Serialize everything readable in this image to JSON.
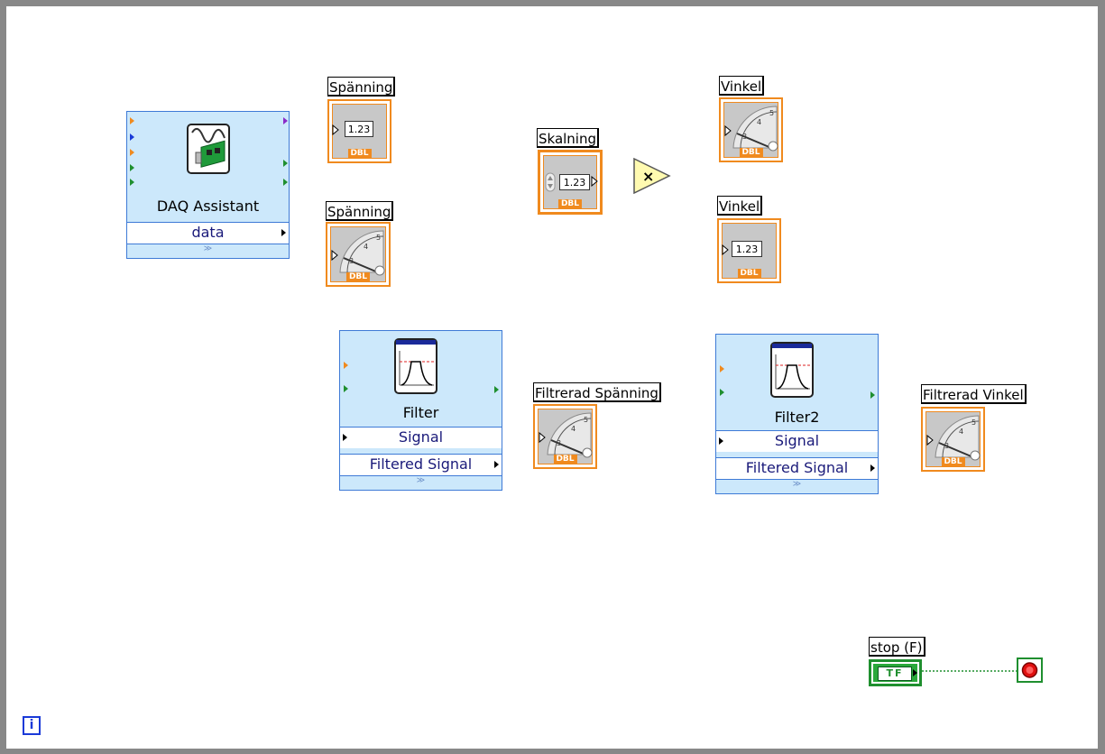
{
  "labels": {
    "spanning_num": "Spänning",
    "spanning_gauge": "Spänning",
    "skalning": "Skalning",
    "vinkel_gauge": "Vinkel",
    "vinkel_num": "Vinkel",
    "filtrerad_spanning": "Filtrerad Spänning",
    "filtrerad_vinkel": "Filtrerad Vinkel",
    "stop": "stop (F)"
  },
  "numeric_display": "1.23",
  "type_badge": "DBL",
  "multiply_symbol": "×",
  "stop_constant": "TF",
  "loop_iteration": "i",
  "daq": {
    "title": "DAQ Assistant",
    "row": "data",
    "icon": "daq-card-icon"
  },
  "filter1": {
    "title": "Filter",
    "rows": [
      "Signal",
      "Filtered Signal"
    ],
    "icon": "bandpass-filter-icon"
  },
  "filter2": {
    "title": "Filter2",
    "rows": [
      "Signal",
      "Filtered Signal"
    ],
    "icon": "bandpass-filter-icon"
  },
  "colors": {
    "loop_border": "#888888",
    "terminal_orange": "#f08a1e",
    "express_blue": "#cce8fb",
    "boolean_green": "#1f8f2f",
    "stop_red": "#e01010"
  }
}
